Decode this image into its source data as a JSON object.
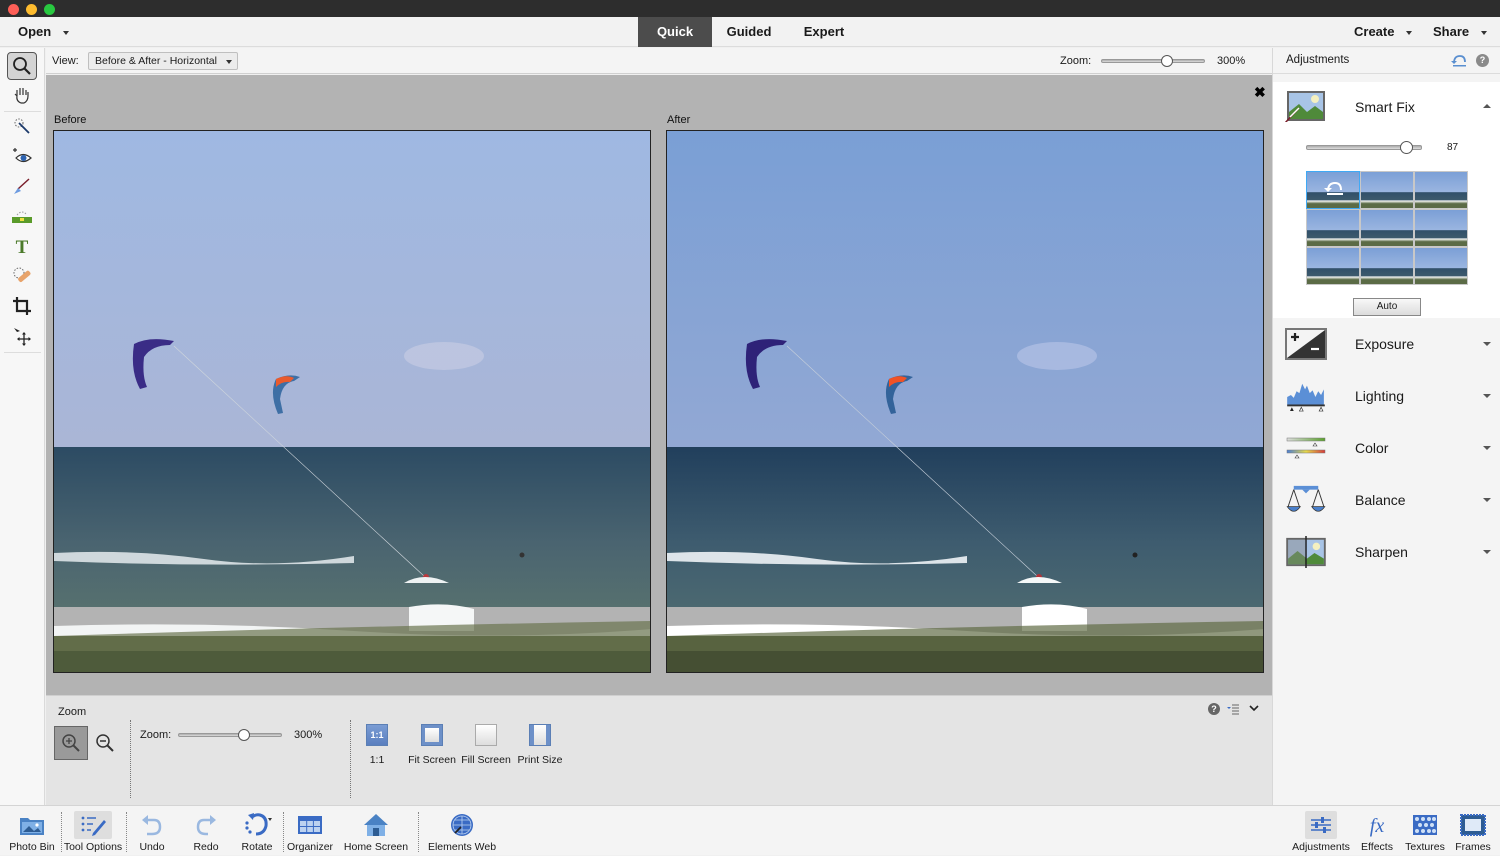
{
  "window": {
    "traffic_lights": [
      "#fe5f57",
      "#febc2e",
      "#28c840"
    ]
  },
  "menubar": {
    "open_label": "Open",
    "modes": [
      {
        "label": "Quick",
        "active": true
      },
      {
        "label": "Guided",
        "active": false
      },
      {
        "label": "Expert",
        "active": false
      }
    ],
    "create_label": "Create",
    "share_label": "Share"
  },
  "tools": [
    {
      "name": "zoom-tool",
      "icon": "magnifier-icon",
      "active": true
    },
    {
      "name": "hand-tool",
      "icon": "hand-icon",
      "active": false
    },
    {
      "name": "quick-selection-tool",
      "icon": "magic-wand-icon",
      "active": false
    },
    {
      "name": "red-eye-tool",
      "icon": "eye-icon",
      "active": false
    },
    {
      "name": "whiten-teeth-tool",
      "icon": "brush-icon",
      "active": false
    },
    {
      "name": "straighten-tool",
      "icon": "level-icon",
      "active": false
    },
    {
      "name": "type-tool",
      "icon": "type-icon",
      "active": false
    },
    {
      "name": "spot-healing-tool",
      "icon": "bandage-icon",
      "active": false
    },
    {
      "name": "crop-tool",
      "icon": "crop-icon",
      "active": false
    },
    {
      "name": "move-tool",
      "icon": "move-icon",
      "active": false
    }
  ],
  "viewbar": {
    "view_label": "View:",
    "view_value": "Before & After - Horizontal",
    "zoom_label": "Zoom:",
    "zoom_value": "300%",
    "zoom_fraction": 0.63
  },
  "canvas": {
    "before_label": "Before",
    "after_label": "After",
    "close_glyph": "✖"
  },
  "tool_options": {
    "title": "Zoom",
    "zoom_label": "Zoom:",
    "zoom_value": "300%",
    "zoom_fraction": 0.63,
    "fit_buttons": [
      {
        "label": "1:1",
        "glyph": "1:1"
      },
      {
        "label": "Fit Screen",
        "glyph": ""
      },
      {
        "label": "Fill Screen",
        "glyph": ""
      },
      {
        "label": "Print Size",
        "glyph": ""
      }
    ]
  },
  "adjustments": {
    "title": "Adjustments",
    "smart_fix": {
      "label": "Smart Fix",
      "value": "87",
      "fraction": 0.87,
      "auto_label": "Auto"
    },
    "sections": [
      {
        "label": "Exposure",
        "icon": "exposure-icon"
      },
      {
        "label": "Lighting",
        "icon": "histogram-icon"
      },
      {
        "label": "Color",
        "icon": "color-sliders-icon"
      },
      {
        "label": "Balance",
        "icon": "scales-icon"
      },
      {
        "label": "Sharpen",
        "icon": "sharpen-icon"
      }
    ]
  },
  "bottombar": {
    "left": [
      {
        "label": "Photo Bin",
        "icon": "photo-bin-icon"
      },
      {
        "label": "Tool Options",
        "icon": "tool-options-icon",
        "active": true
      },
      {
        "label": "Undo",
        "icon": "undo-icon"
      },
      {
        "label": "Redo",
        "icon": "redo-icon"
      },
      {
        "label": "Rotate",
        "icon": "rotate-icon"
      },
      {
        "label": "Organizer",
        "icon": "organizer-icon"
      },
      {
        "label": "Home Screen",
        "icon": "home-icon"
      },
      {
        "label": "Elements Web",
        "icon": "globe-icon"
      }
    ],
    "right": [
      {
        "label": "Adjustments",
        "icon": "adjustments-icon",
        "active": true
      },
      {
        "label": "Effects",
        "icon": "fx-icon"
      },
      {
        "label": "Textures",
        "icon": "textures-icon"
      },
      {
        "label": "Frames",
        "icon": "frames-icon"
      }
    ]
  }
}
